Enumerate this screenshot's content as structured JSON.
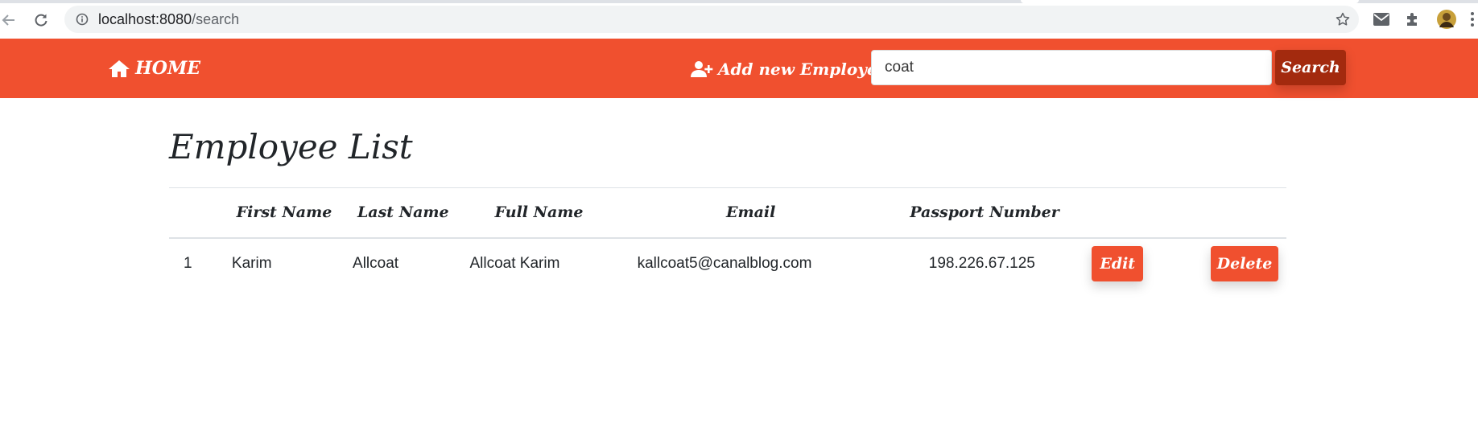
{
  "browser": {
    "url_host": "localhost:8080",
    "url_path": "/search",
    "icons": [
      "back-arrow-icon",
      "reload-icon",
      "site-info-icon",
      "bookmark-star-icon",
      "mail-icon",
      "extensions-puzzle-icon",
      "profile-avatar",
      "menu-dots-icon"
    ]
  },
  "navbar": {
    "home_label": "HOME",
    "add_label": "Add new Employee",
    "search_value": "coat",
    "search_button": "Search",
    "bg_color": "#f0502f",
    "search_button_color": "#a32a0e"
  },
  "page": {
    "title": "Employee List"
  },
  "table": {
    "headers": [
      "",
      "First Name",
      "Last Name",
      "Full Name",
      "Email",
      "Passport Number",
      "",
      ""
    ],
    "rows": [
      {
        "index": "1",
        "first_name": "Karim",
        "last_name": "Allcoat",
        "full_name": "Allcoat Karim",
        "email": "kallcoat5@canalblog.com",
        "passport": "198.226.67.125",
        "edit_label": "Edit",
        "delete_label": "Delete"
      }
    ]
  }
}
